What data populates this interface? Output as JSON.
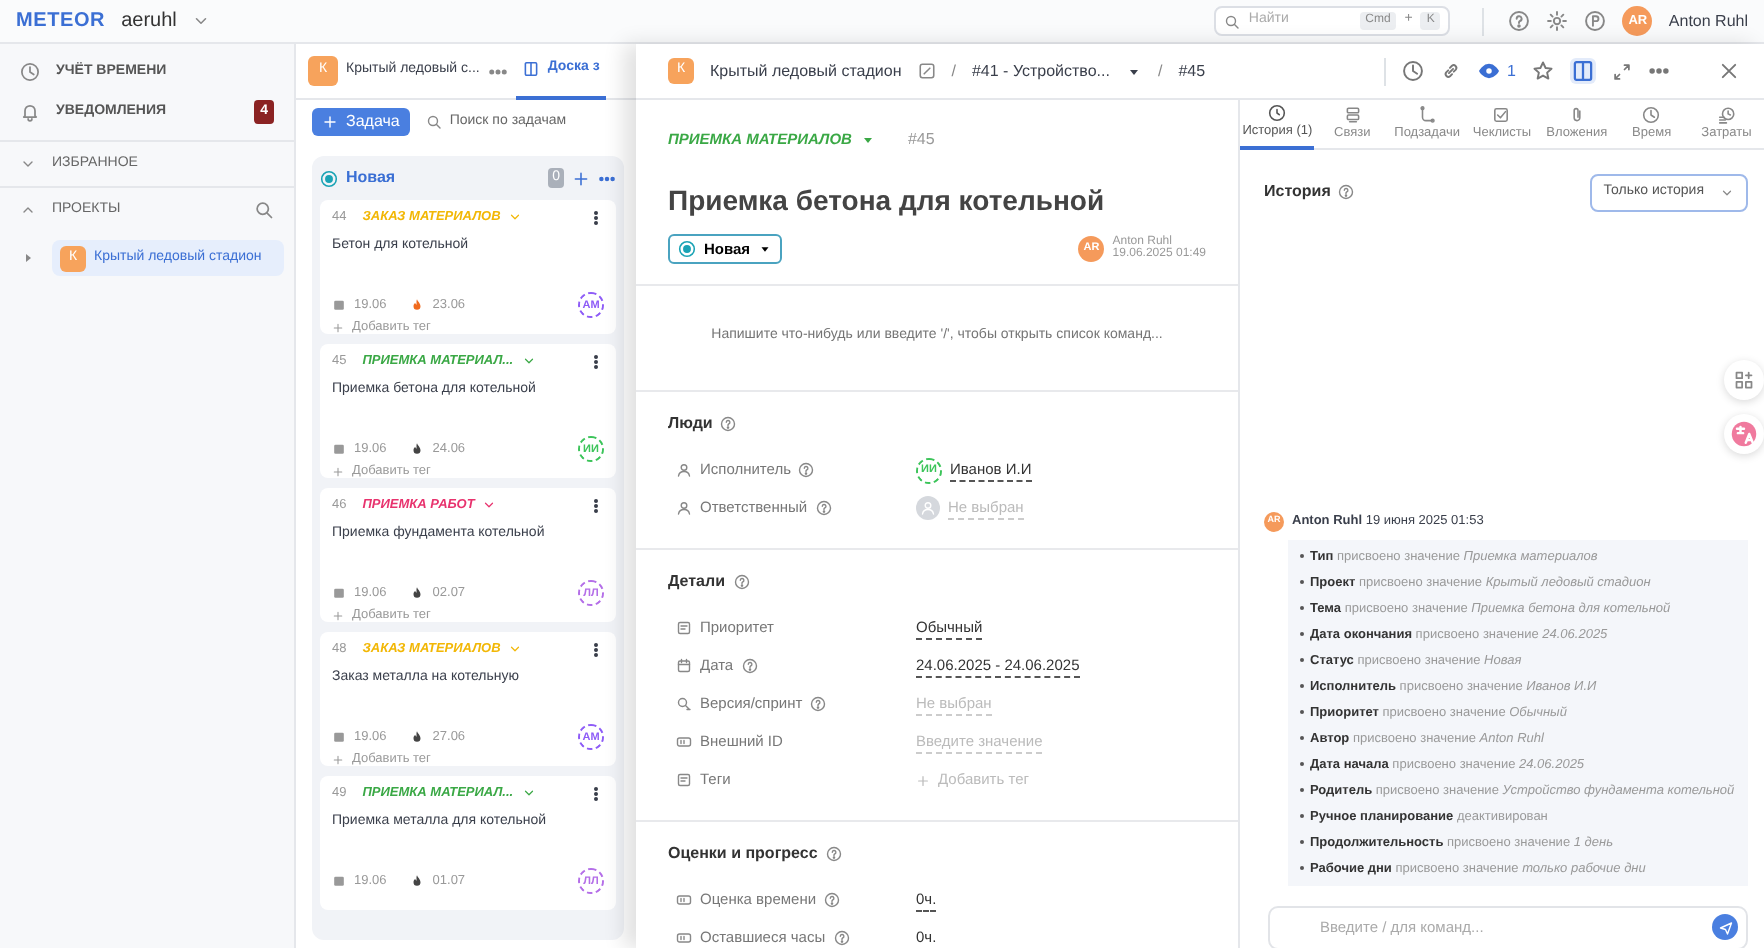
{
  "topbar": {
    "logo": "METEOR",
    "workspace": "aeruhl",
    "search": {
      "placeholder": "Найти",
      "keys": [
        "Cmd",
        "+",
        "K"
      ]
    },
    "user": {
      "initials": "AR",
      "name": "Anton Ruhl"
    }
  },
  "sidebar": {
    "nav": [
      {
        "label": "УЧЁТ ВРЕМЕНИ"
      },
      {
        "label": "УВЕДОМЛЕНИЯ",
        "badge": "4"
      }
    ],
    "favorites": {
      "label": "ИЗБРАННОЕ",
      "expanded": false
    },
    "projects": {
      "label": "ПРОЕКТЫ",
      "expanded": true,
      "items": [
        {
          "initial": "К",
          "name": "Крытый ледовый стадион",
          "selected": true,
          "expanded": false
        }
      ]
    }
  },
  "board": {
    "project_initial": "К",
    "project_name": "Крытый ледовый с...",
    "tab_label": "Доска з",
    "add_button": "Задача",
    "search_placeholder": "Поиск по задачам",
    "column": {
      "name": "Новая",
      "count": "0",
      "cards": [
        {
          "number": "44",
          "type": {
            "label": "ЗАКАЗ МАТЕРИАЛОВ",
            "color": "#f2b705"
          },
          "title": "Бетон для котельной",
          "start": "19.06",
          "due": "23.06",
          "due_soon": true,
          "assignee": {
            "initials": "АМ",
            "color": "#8e5cf7"
          },
          "add_tag": "Добавить тег"
        },
        {
          "number": "45",
          "type": {
            "label": "ПРИЕМКА МАТЕРИАЛ...",
            "color": "#3aa845"
          },
          "title": "Приемка бетона для котельной",
          "start": "19.06",
          "due": "24.06",
          "due_soon": false,
          "assignee": {
            "initials": "ИИ",
            "color": "#3cc45a"
          },
          "add_tag": "Добавить тег"
        },
        {
          "number": "46",
          "type": {
            "label": "ПРИЕМКА РАБОТ",
            "color": "#e8336e"
          },
          "title": "Приемка фундамента котельной",
          "start": "19.06",
          "due": "02.07",
          "due_soon": false,
          "assignee": {
            "initials": "ЛЛ",
            "color": "#b46ee8"
          },
          "add_tag": "Добавить тег"
        },
        {
          "number": "48",
          "type": {
            "label": "ЗАКАЗ МАТЕРИАЛОВ",
            "color": "#f2b705"
          },
          "title": "Заказ металла на котельную",
          "start": "19.06",
          "due": "27.06",
          "due_soon": false,
          "assignee": {
            "initials": "АМ",
            "color": "#8e5cf7"
          },
          "add_tag": "Добавить тег"
        },
        {
          "number": "49",
          "type": {
            "label": "ПРИЕМКА МАТЕРИАЛ...",
            "color": "#3aa845"
          },
          "title": "Приемка металла для котельной",
          "start": "19.06",
          "due": "01.07",
          "due_soon": false,
          "assignee": {
            "initials": "ЛЛ",
            "color": "#b46ee8"
          }
        }
      ]
    }
  },
  "detail": {
    "breadcrumb": {
      "initial": "К",
      "project": "Крытый ледовый стадион",
      "separators": [
        "/",
        "/"
      ],
      "parent": "#41 - Устройство...",
      "id": "#45"
    },
    "watchers": "1",
    "split_view": true,
    "type": {
      "label": "ПРИЕМКА МАТЕРИАЛОВ",
      "color": "#3aa845"
    },
    "number": "#45",
    "title": "Приемка бетона для котельной",
    "status": "Новая",
    "author": {
      "initials": "AR",
      "name": "Anton Ruhl",
      "time": "19.06.2025 01:49"
    },
    "editor_placeholder": "Напишите что-нибудь или введите '/', чтобы открыть список команд...",
    "sections": [
      {
        "title": "Люди",
        "fields": [
          {
            "kind": "person",
            "label": "Исполнитель",
            "help": true,
            "value": "Иванов И.И",
            "initials": "ИИ",
            "color": "#3cc45a",
            "empty": false
          },
          {
            "kind": "person",
            "label": "Ответственный",
            "help": true,
            "value": "Не выбран",
            "empty": true
          }
        ]
      },
      {
        "title": "Детали",
        "fields": [
          {
            "kind": "priority",
            "label": "Приоритет",
            "value": "Обычный",
            "empty": false
          },
          {
            "kind": "date",
            "label": "Дата",
            "help": true,
            "value": "24.06.2025 - 24.06.2025",
            "empty": false
          },
          {
            "kind": "sprint",
            "label": "Версия/спринт",
            "help": true,
            "value": "Не выбран",
            "empty": true
          },
          {
            "kind": "external",
            "label": "Внешний ID",
            "placeholder": "Введите значение"
          },
          {
            "kind": "tags",
            "label": "Теги",
            "value": "Добавить тег",
            "empty": true
          }
        ]
      },
      {
        "title": "Оценки и прогресс",
        "fields": [
          {
            "kind": "estimate",
            "label": "Оценка времени",
            "help": true,
            "value": "0ч.",
            "empty": false
          },
          {
            "kind": "remaining",
            "label": "Оставшиеся часы",
            "help": true,
            "value": "0ч.",
            "empty": false
          }
        ]
      }
    ]
  },
  "activity": {
    "tabs": [
      {
        "label": "История (1)",
        "selected": true
      },
      {
        "label": "Связи",
        "selected": false
      },
      {
        "label": "Подзадачи",
        "selected": false
      },
      {
        "label": "Чеклисты",
        "selected": false
      },
      {
        "label": "Вложения",
        "selected": false
      },
      {
        "label": "Время",
        "selected": false
      },
      {
        "label": "Затраты",
        "selected": false
      }
    ],
    "heading": "История",
    "filter": "Только история",
    "entry": {
      "initials": "AR",
      "author": "Anton Ruhl",
      "time": "19 июня 2025 01:53",
      "changes": [
        "**Тип** присвоено значение *Приемка материалов*",
        "**Проект** присвоено значение *Крытый ледовый стадион*",
        "**Тема** присвоено значение *Приемка бетона для котельной*",
        "**Дата окончания** присвоено значение *24.06.2025*",
        "**Статус** присвоено значение *Новая*",
        "**Исполнитель** присвоено значение *Иванов И.И*",
        "**Приоритет** присвоено значение *Обычный*",
        "**Автор** присвоено значение *Anton Ruhl*",
        "**Дата начала** присвоено значение *24.06.2025*",
        "**Родитель** присвоено значение *Устройство фундамента котельной*",
        "**Ручное планирование** деактивирован",
        "**Продолжительность** присвоено значение *1 день*",
        "**Рабочие дни** присвоено значение *только рабочие дни*"
      ]
    },
    "comment_placeholder": "Введите / для команд..."
  }
}
